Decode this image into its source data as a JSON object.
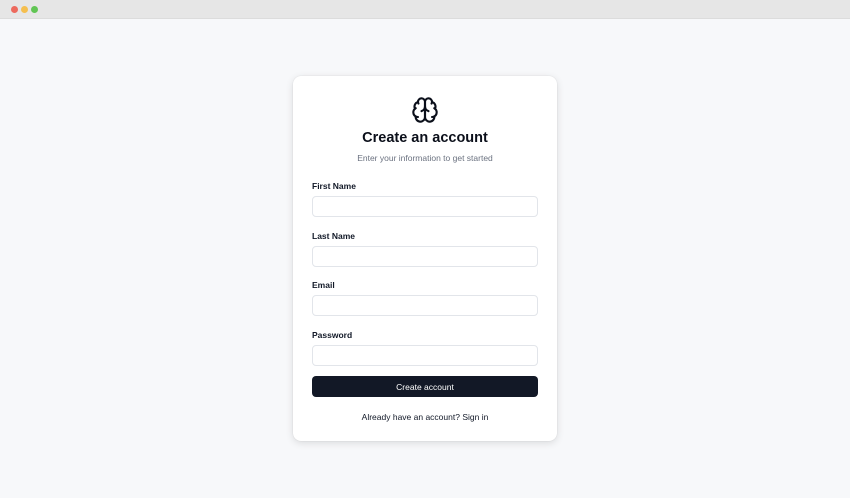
{
  "window": {
    "controls": [
      "close",
      "minimize",
      "maximize"
    ],
    "colors": {
      "close": "#ed6a5e",
      "minimize": "#f5bf4f",
      "maximize": "#61c554"
    }
  },
  "card": {
    "logo_icon": "brain-icon",
    "title": "Create an account",
    "subtitle": "Enter your information to get started"
  },
  "form": {
    "first_name": {
      "label": "First Name",
      "value": "",
      "placeholder": ""
    },
    "last_name": {
      "label": "Last Name",
      "value": "",
      "placeholder": ""
    },
    "email": {
      "label": "Email",
      "value": "",
      "placeholder": ""
    },
    "password": {
      "label": "Password",
      "value": "",
      "placeholder": ""
    },
    "submit_label": "Create account"
  },
  "footer": {
    "prompt": "Already have an account?",
    "link_label": "Sign in"
  },
  "colors": {
    "background": "#f7f8fa",
    "card": "#ffffff",
    "button": "#121826",
    "text": "#0b0f1a",
    "muted": "#6b7280"
  }
}
